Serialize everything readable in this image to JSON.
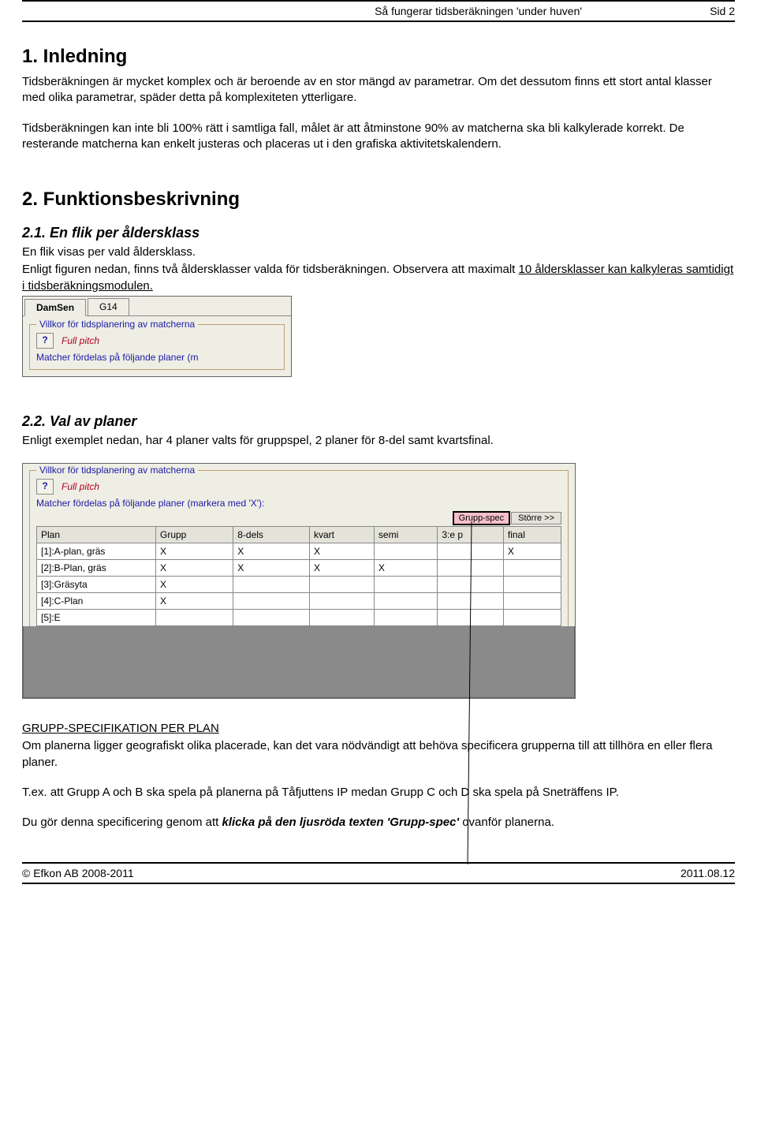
{
  "header": {
    "title": "Så fungerar tidsberäkningen 'under huven'",
    "page": "Sid 2"
  },
  "sec1": {
    "title": "1. Inledning",
    "p1": "Tidsberäkningen är mycket komplex och är beroende av en stor mängd av parametrar. Om det dessutom finns ett stort antal klasser med olika parametrar, späder detta på komplexiteten ytterligare.",
    "p2": "Tidsberäkningen kan inte bli 100% rätt i samtliga fall, målet är att åtminstone 90% av matcherna ska bli kalkylerade korrekt. De resterande matcherna kan enkelt justeras och placeras ut i den grafiska aktivitetskalendern."
  },
  "sec2": {
    "title": "2. Funktionsbeskrivning",
    "s21": {
      "title": "2.1. En flik per åldersklass",
      "p1": "En flik visas per vald åldersklass.",
      "p2a": "Enligt figuren nedan, finns två åldersklasser valda för tidsberäkningen. Observera att maximalt ",
      "p2b": "10 åldersklasser kan kalkyleras samtidigt i tidsberäkningsmodulen."
    },
    "s22": {
      "title": "2.2. Val av planer",
      "p1": "Enligt exemplet nedan, har 4 planer valts för gruppspel, 2 planer för 8-del samt kvartsfinal."
    }
  },
  "shot1": {
    "tab_active": "DamSen",
    "tab_other": "G14",
    "group_legend": "Villkor för tidsplanering av matcherna",
    "help": "?",
    "fullpitch": "Full pitch",
    "distrib": "Matcher fördelas på följande planer (m"
  },
  "shot2": {
    "group_legend": "Villkor för tidsplanering av matcherna",
    "help": "?",
    "fullpitch": "Full pitch",
    "distrib": "Matcher fördelas på följande planer (markera med 'X'):",
    "btn_pink": "Grupp-spec",
    "btn_grey": "Större >>",
    "cols": [
      "Plan",
      "Grupp",
      "8-dels",
      "kvart",
      "semi",
      "3:e p",
      "final"
    ],
    "rows": [
      {
        "plan": "[1]:A-plan, gräs",
        "cells": [
          "X",
          "X",
          "X",
          "",
          "",
          "X"
        ]
      },
      {
        "plan": "[2]:B-Plan, gräs",
        "cells": [
          "X",
          "X",
          "X",
          "X",
          "",
          ""
        ]
      },
      {
        "plan": "[3]:Gräsyta",
        "cells": [
          "X",
          "",
          "",
          "",
          "",
          ""
        ]
      },
      {
        "plan": "[4]:C-Plan",
        "cells": [
          "X",
          "",
          "",
          "",
          "",
          ""
        ]
      },
      {
        "plan": "[5]:E",
        "cells": [
          "",
          "",
          "",
          "",
          "",
          ""
        ]
      }
    ]
  },
  "groupspec": {
    "title": "GRUPP-SPECIFIKATION PER PLAN",
    "p1": "Om planerna ligger geografiskt olika placerade, kan det vara nödvändigt att behöva specificera grupperna till att tillhöra en eller flera planer.",
    "p2": "T.ex. att Grupp A och B ska spela på planerna på Tåfjuttens IP medan Grupp C och D ska spela på Sneträffens IP.",
    "p3a": "Du gör denna specificering  genom att ",
    "p3b": "klicka på den ljusröda texten 'Grupp-spec'",
    "p3c": " ovanför planerna."
  },
  "footer": {
    "left": "© Efkon AB 2008-2011",
    "right": "2011.08.12"
  }
}
